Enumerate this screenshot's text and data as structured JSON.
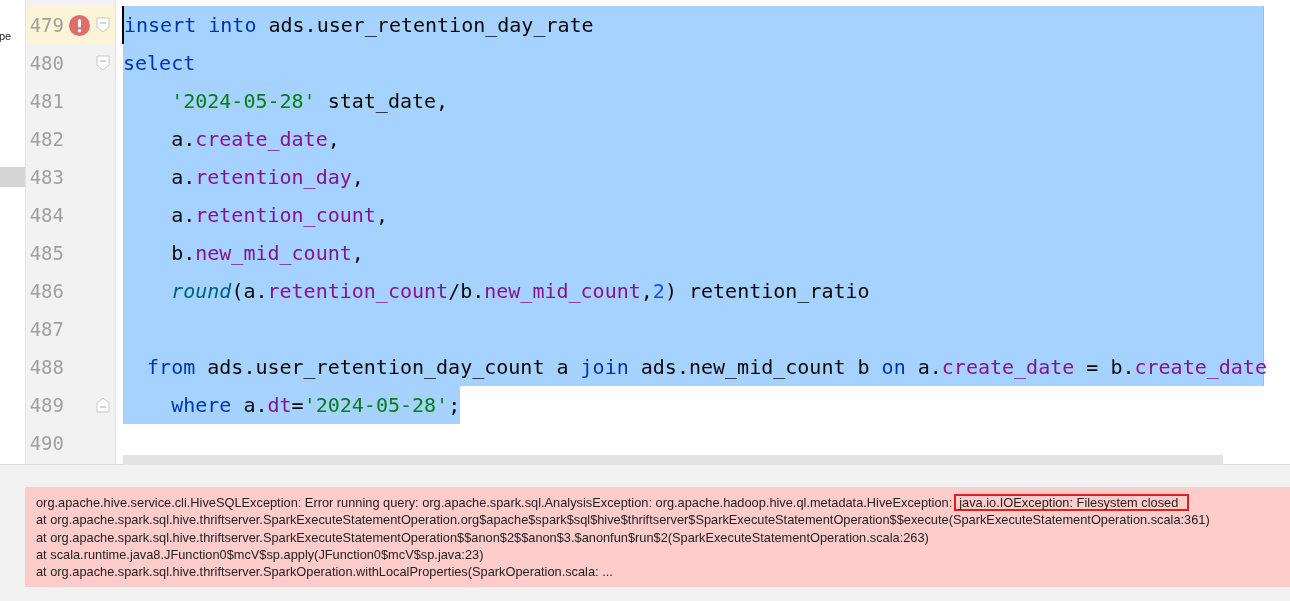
{
  "side_panel": {
    "fragment": "pe"
  },
  "editor": {
    "lines": [
      {
        "number": "479",
        "current": true,
        "error": true,
        "fold_start": true,
        "fold_end": false,
        "selected": true,
        "tokens": [
          {
            "kind": "kw",
            "text": "insert into"
          },
          {
            "kind": "plain",
            "text": " ads.user_retention_day_rate"
          }
        ]
      },
      {
        "number": "480",
        "current": false,
        "error": false,
        "fold_start": true,
        "fold_end": false,
        "selected": true,
        "tokens": [
          {
            "kind": "kw",
            "text": "select"
          }
        ]
      },
      {
        "number": "481",
        "current": false,
        "error": false,
        "fold_start": false,
        "fold_end": false,
        "selected": true,
        "tokens": [
          {
            "kind": "str",
            "text": "    '2024-05-28'"
          },
          {
            "kind": "plain",
            "text": " stat_date,"
          }
        ]
      },
      {
        "number": "482",
        "current": false,
        "error": false,
        "fold_start": false,
        "fold_end": false,
        "selected": true,
        "tokens": [
          {
            "kind": "plain",
            "text": "    a."
          },
          {
            "kind": "field",
            "text": "create_date"
          },
          {
            "kind": "plain",
            "text": ","
          }
        ]
      },
      {
        "number": "483",
        "current": false,
        "error": false,
        "fold_start": false,
        "fold_end": false,
        "selected": true,
        "tokens": [
          {
            "kind": "plain",
            "text": "    a."
          },
          {
            "kind": "field",
            "text": "retention_day"
          },
          {
            "kind": "plain",
            "text": ","
          }
        ]
      },
      {
        "number": "484",
        "current": false,
        "error": false,
        "fold_start": false,
        "fold_end": false,
        "selected": true,
        "tokens": [
          {
            "kind": "plain",
            "text": "    a."
          },
          {
            "kind": "field",
            "text": "retention_count"
          },
          {
            "kind": "plain",
            "text": ","
          }
        ]
      },
      {
        "number": "485",
        "current": false,
        "error": false,
        "fold_start": false,
        "fold_end": false,
        "selected": true,
        "tokens": [
          {
            "kind": "plain",
            "text": "    b."
          },
          {
            "kind": "field",
            "text": "new_mid_count"
          },
          {
            "kind": "plain",
            "text": ","
          }
        ]
      },
      {
        "number": "486",
        "current": false,
        "error": false,
        "fold_start": false,
        "fold_end": false,
        "selected": true,
        "tokens": [
          {
            "kind": "fn",
            "text": "    round"
          },
          {
            "kind": "plain",
            "text": "(a."
          },
          {
            "kind": "field",
            "text": "retention_count"
          },
          {
            "kind": "plain",
            "text": "/b."
          },
          {
            "kind": "field",
            "text": "new_mid_count"
          },
          {
            "kind": "plain",
            "text": ","
          },
          {
            "kind": "num",
            "text": "2"
          },
          {
            "kind": "plain",
            "text": ") retention_ratio"
          }
        ]
      },
      {
        "number": "487",
        "current": false,
        "error": false,
        "fold_start": false,
        "fold_end": false,
        "selected": true
      },
      {
        "number": "488",
        "current": false,
        "error": false,
        "fold_start": false,
        "fold_end": false,
        "selected": true,
        "tokens": [
          {
            "kind": "kw",
            "text": "  from"
          },
          {
            "kind": "plain",
            "text": " ads.user_retention_day_count a "
          },
          {
            "kind": "kw",
            "text": "join"
          },
          {
            "kind": "plain",
            "text": " ads.new_mid_count b "
          },
          {
            "kind": "kw",
            "text": "on"
          },
          {
            "kind": "plain",
            "text": " a."
          },
          {
            "kind": "field",
            "text": "create_date"
          },
          {
            "kind": "plain",
            "text": " = b."
          },
          {
            "kind": "field",
            "text": "create_date"
          }
        ]
      },
      {
        "number": "489",
        "current": false,
        "error": false,
        "fold_start": false,
        "fold_end": true,
        "selected": true,
        "partial_selection": true,
        "tokens": [
          {
            "kind": "kw",
            "text": "    where"
          },
          {
            "kind": "plain",
            "text": " a."
          },
          {
            "kind": "field",
            "text": "dt"
          },
          {
            "kind": "plain",
            "text": "="
          },
          {
            "kind": "str",
            "text": "'2024-05-28'"
          },
          {
            "kind": "plain",
            "text": ";"
          }
        ]
      },
      {
        "number": "490",
        "current": false,
        "error": false,
        "fold_start": false,
        "fold_end": false,
        "selected": false
      }
    ]
  },
  "error_panel": {
    "first_line": {
      "text": "org.apache.hive.service.cli.HiveSQLException: Error running query: org.apache.spark.sql.AnalysisException: org.apache.hadoop.hive.ql.metadata.HiveException:",
      "boxed": "java.io.IOException: Filesystem closed"
    },
    "lines": [
      "at org.apache.spark.sql.hive.thriftserver.SparkExecuteStatementOperation.org$apache$spark$sql$hive$thriftserver$SparkExecuteStatementOperation$$execute(SparkExecuteStatementOperation.scala:361)",
      "at org.apache.spark.sql.hive.thriftserver.SparkExecuteStatementOperation$$anon$2$$anon$3.$anonfun$run$2(SparkExecuteStatementOperation.scala:263)",
      "at scala.runtime.java8.JFunction0$mcV$sp.apply(JFunction0$mcV$sp.java:23)",
      "at org.apache.spark.sql.hive.thriftserver.SparkOperation.withLocalProperties(SparkOperation.scala: ..."
    ]
  }
}
